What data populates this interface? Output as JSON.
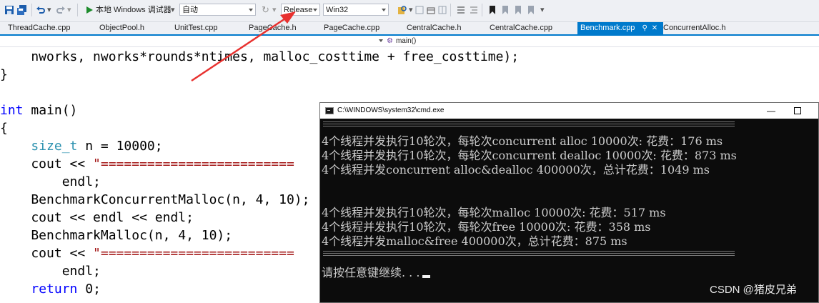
{
  "toolbar": {
    "debugger_label": "本地 Windows 调试器",
    "mode_value": "自动",
    "config_value": "Release",
    "platform_value": "Win32"
  },
  "tabs": [
    {
      "label": "ThreadCache.cpp"
    },
    {
      "label": "ObjectPool.h"
    },
    {
      "label": "UnitTest.cpp"
    },
    {
      "label": "PageCache.h"
    },
    {
      "label": "PageCache.cpp"
    },
    {
      "label": "CentralCache.h"
    },
    {
      "label": "CentralCache.cpp"
    },
    {
      "label": "Benchmark.cpp",
      "active": true
    },
    {
      "label": "ConcurrentAlloc.h"
    }
  ],
  "navbar": {
    "function": "main()"
  },
  "code": {
    "line1": "    nworks, nworks*rounds*ntimes, malloc_costtime + free_costtime);",
    "line2": "}",
    "line3_kw": "int",
    "line3_rest": " main()",
    "line4": "{",
    "line5_type": "size_t",
    "line5_rest": " n = 10000;",
    "line6_a": "    cout << ",
    "line6_str": "\"=========================",
    "line7": "        endl;",
    "line8": "    BenchmarkConcurrentMalloc(n, 4, 10);",
    "line9": "    cout << endl << endl;",
    "line10": "    BenchmarkMalloc(n, 4, 10);",
    "line11_a": "    cout << ",
    "line11_str": "\"=========================",
    "line12": "        endl;",
    "line13_kw": "return",
    "line13_rest": " 0;"
  },
  "console": {
    "title": "C:\\WINDOWS\\system32\\cmd.exe",
    "minimize": "—",
    "lines": [
      "4个线程并发执行10轮次，每轮次concurrent alloc 10000次: 花费：176 ms",
      "4个线程并发执行10轮次，每轮次concurrent dealloc 10000次: 花费：873 ms",
      "4个线程并发concurrent alloc&dealloc 400000次，总计花费：1049 ms",
      "4个线程并发执行10轮次，每轮次malloc 10000次: 花费：517 ms",
      "4个线程并发执行10轮次，每轮次free 10000次: 花费：358 ms",
      "4个线程并发malloc&free 400000次，总计花费：875 ms",
      "请按任意键继续. . ."
    ]
  },
  "watermark": "CSDN @猪皮兄弟",
  "colors": {
    "accent": "#007acc",
    "arrow": "#e8312f",
    "console_bg": "#0c0c0c",
    "keyword": "#0000ff",
    "type": "#2b91af",
    "string": "#a31515"
  }
}
